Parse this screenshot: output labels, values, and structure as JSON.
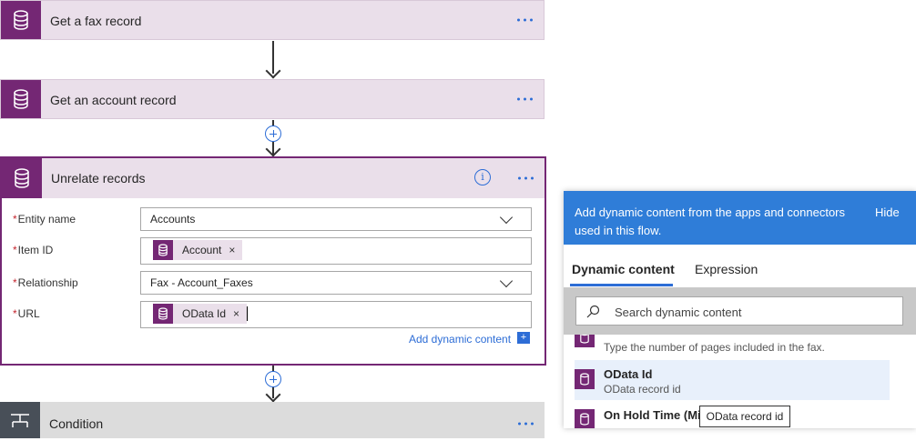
{
  "cards": {
    "fax": {
      "title": "Get a fax record"
    },
    "account": {
      "title": "Get an account record"
    },
    "unrelate": {
      "title": "Unrelate records"
    },
    "condition": {
      "title": "Condition"
    }
  },
  "fields": {
    "entity_name": {
      "label": "Entity name",
      "value": "Accounts"
    },
    "item_id": {
      "label": "Item ID",
      "token": "Account"
    },
    "relationship": {
      "label": "Relationship",
      "value": "Fax - Account_Faxes"
    },
    "url": {
      "label": "URL",
      "token": "OData Id"
    },
    "required_mark": "*"
  },
  "add_dynamic": {
    "label": "Add dynamic content",
    "button": "+"
  },
  "panel": {
    "header_text": "Add dynamic content from the apps and connectors used in this flow.",
    "hide_label": "Hide",
    "tabs": [
      "Dynamic content",
      "Expression"
    ],
    "search_placeholder": "Search dynamic content",
    "items": [
      {
        "name": "",
        "desc": "Type the number of pages included in the fax."
      },
      {
        "name": "OData Id",
        "desc": "OData record id"
      },
      {
        "name": "On Hold Time (Min",
        "desc": ""
      }
    ]
  },
  "tooltip": "OData record id",
  "colors": {
    "connector": "#742774",
    "card_bg": "#eadfea",
    "accent": "#2d6dd6",
    "panel_header": "#2f7dd8",
    "required": "#c4262e"
  },
  "icons": {
    "connector": "database-icon",
    "more": "more-dots-icon",
    "info": "info-icon",
    "dropdown": "chevron-down-icon",
    "add": "plus-icon",
    "remove": "close-icon",
    "search": "search-icon",
    "condition": "condition-icon"
  }
}
